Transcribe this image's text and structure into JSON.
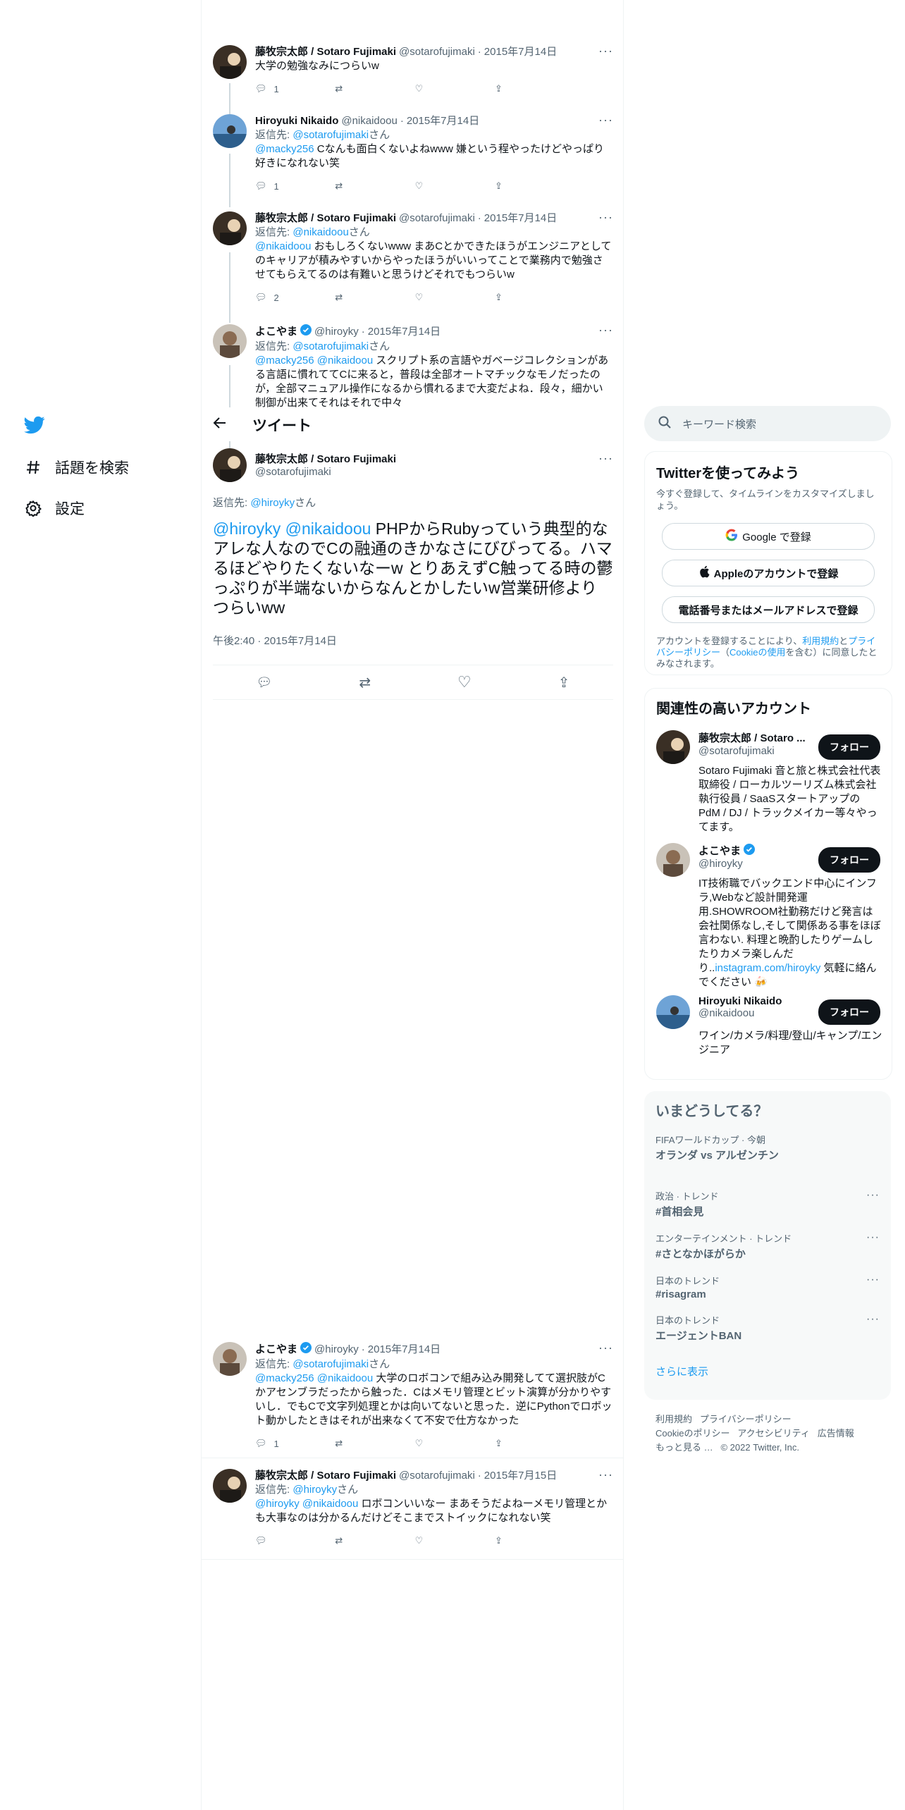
{
  "nav": {
    "items": [
      {
        "label": "話題を検索",
        "icon": "hashtag-icon"
      },
      {
        "label": "設定",
        "icon": "gear-icon"
      }
    ]
  },
  "header": {
    "title": "ツイート"
  },
  "thread": [
    {
      "name": "藤牧宗太郎 / Sotaro Fujimaki",
      "handle": "@sotarofujimaki",
      "date": "2015年7月14日",
      "reply_prefix": "",
      "reply_to": "",
      "reply_suffix": "",
      "mentions": "",
      "text": "大学の勉強なみにつらいw",
      "replies": "1",
      "retweets": "",
      "likes": ""
    },
    {
      "name": "Hiroyuki Nikaido",
      "handle": "@nikaidoou",
      "date": "2015年7月14日",
      "reply_prefix": "返信先: ",
      "reply_to": "@sotarofujimaki",
      "reply_suffix": "さん",
      "mentions": "@macky256",
      "text": " Cなんも面白くないよねwww 嫌という程やったけどやっぱり好きになれない笑",
      "replies": "1",
      "retweets": "",
      "likes": ""
    },
    {
      "name": "藤牧宗太郎 / Sotaro Fujimaki",
      "handle": "@sotarofujimaki",
      "date": "2015年7月14日",
      "reply_prefix": "返信先: ",
      "reply_to": "@nikaidoou",
      "reply_suffix": "さん",
      "mentions": "@nikaidoou",
      "text": " おもしろくないwww まあCとかできたほうがエンジニアとしてのキャリアが積みやすいからやったほうがいいってことで業務内で勉強させてもらえてるのは有難いと思うけどそれでもつらいw",
      "replies": "2",
      "retweets": "",
      "likes": ""
    },
    {
      "name": "よこやま",
      "handle": "@hiroyky",
      "date": "2015年7月14日",
      "reply_prefix": "返信先: ",
      "reply_to": "@sotarofujimaki",
      "reply_suffix": "さん",
      "mentions": "@macky256 @nikaidoou",
      "text": " スクリプト系の言語やガベージコレクションがある言語に慣れててCに来ると，普段は全部オートマチックなモノだったのが，全部マニュアル操作になるから慣れるまで大変だよね．段々，細かい制御が出来てそれはそれで中々",
      "replies": "",
      "retweets": "",
      "likes": ""
    }
  ],
  "main_tweet": {
    "name": "藤牧宗太郎 / Sotaro Fujimaki",
    "handle": "@sotarofujimaki",
    "reply_prefix": "返信先: ",
    "reply_to": "@hiroyky",
    "reply_suffix": "さん",
    "mentions": "@hiroyky @nikaidoou",
    "text": " PHPからRubyっていう典型的なアレな人なのでCの融通のきかなさにびびってる。ハマるほどやりたくないなーw とりあえずC触ってる時の鬱っぷりが半端ないからなんとかしたいw営業研修よりつらいww",
    "timestamp": "午後2:40 · 2015年7月14日"
  },
  "replies_below": [
    {
      "name": "よこやま",
      "handle": "@hiroyky",
      "date": "2015年7月14日",
      "reply_prefix": "返信先: ",
      "reply_to": "@sotarofujimaki",
      "reply_suffix": "さん",
      "mentions": "@macky256 @nikaidoou",
      "text": " 大学のロボコンで組み込み開発してて選択肢がCかアセンブラだったから触った．Cはメモリ管理とビット演算が分かりやすいし．でもCで文字列処理とかは向いてないと思った．逆にPythonでロボット動かしたときはそれが出来なくて不安で仕方なかった",
      "replies": "1",
      "retweets": "",
      "likes": ""
    },
    {
      "name": "藤牧宗太郎 / Sotaro Fujimaki",
      "handle": "@sotarofujimaki",
      "date": "2015年7月15日",
      "reply_prefix": "返信先: ",
      "reply_to": "@hiroyky",
      "reply_suffix": "さん",
      "mentions": "@hiroyky @nikaidoou",
      "text": " ロボコンいいなー まあそうだよねーメモリ管理とかも大事なのは分かるんだけどそこまでストイックになれない笑",
      "replies": "",
      "retweets": "",
      "likes": ""
    }
  ],
  "search": {
    "placeholder": "キーワード検索"
  },
  "signup": {
    "title": "Twitterを使ってみよう",
    "subtitle": "今すぐ登録して、タイムラインをカスタマイズしましょう。",
    "google": "Google で登録",
    "apple": "Appleのアカウントで登録",
    "phone": "電話番号またはメールアドレスで登録",
    "legal_1": "アカウントを登録することにより、",
    "legal_terms": "利用規約",
    "legal_2": "と",
    "legal_privacy": "プライバシーポリシー",
    "legal_3": "（",
    "legal_cookie": "Cookieの使用",
    "legal_4": "を含む）に同意したとみなされます。"
  },
  "related": {
    "title": "関連性の高いアカウント",
    "follow_label": "フォロー",
    "accounts": [
      {
        "name": "藤牧宗太郎 / Sotaro ...",
        "handle": "@sotarofujimaki",
        "bio": "Sotaro Fujimaki 音と旅と株式会社代表取締役 / ローカルツーリズム株式会社執行役員 / SaaSスタートアップのPdM / DJ / トラックメイカー等々やってます。",
        "verified": false
      },
      {
        "name": "よこやま",
        "handle": "@hiroyky",
        "bio": "IT技術職でバックエンド中心にインフラ,Webなど設計開発運用.SHOWROOM社勤務だけど発言は会社関係なし,そして関係ある事をほぼ言わない. 料理と晩酌したりゲームしたりカメラ楽しんだり..",
        "bio_link": "instagram.com/hiroyky",
        "bio_tail": " 気軽に絡んでください 🍻",
        "verified": true
      },
      {
        "name": "Hiroyuki Nikaido",
        "handle": "@nikaidoou",
        "bio": "ワイン/カメラ/料理/登山/キャンプ/エンジニア",
        "verified": false
      }
    ]
  },
  "trends": {
    "title": "いまどうしてる？",
    "items": [
      {
        "category": "FIFAワールドカップ · 今朝",
        "topic": "オランダ vs アルゼンチン"
      },
      {
        "category": "政治 · トレンド",
        "topic": "#首相会見"
      },
      {
        "category": "エンターテインメント · トレンド",
        "topic": "#さとなかほがらか"
      },
      {
        "category": "日本のトレンド",
        "topic": "#risagram"
      },
      {
        "category": "日本のトレンド",
        "topic": "エージェントBAN"
      }
    ],
    "show_more": "さらに表示"
  },
  "footer": {
    "links": [
      "利用規約",
      "プライバシーポリシー",
      "Cookieのポリシー",
      "アクセシビリティ",
      "広告情報",
      "もっと見る …"
    ],
    "copyright": "© 2022 Twitter, Inc."
  },
  "colors": {
    "accent": "#1d9bf0",
    "text": "#0f1419",
    "secondary": "#536471",
    "border": "#eff3f4",
    "verified": "#1d9bf0"
  }
}
